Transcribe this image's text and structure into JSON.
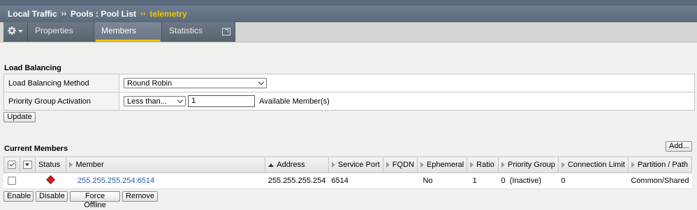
{
  "breadcrumb": {
    "items": [
      "Local Traffic",
      "Pools : Pool List"
    ],
    "separator": "››",
    "current": "telemetry"
  },
  "tabs": {
    "gear_icon": "gear-icon",
    "properties": "Properties",
    "members": "Members",
    "statistics": "Statistics"
  },
  "load_balancing": {
    "title": "Load Balancing",
    "method_label": "Load Balancing Method",
    "method_value": "Round Robin",
    "priority_label": "Priority Group Activation",
    "priority_value": "Less than...",
    "priority_input": "1",
    "priority_suffix": "Available Member(s)",
    "update_button": "Update"
  },
  "current_members": {
    "title": "Current Members",
    "add_button": "Add...",
    "columns": [
      "Status",
      "Member",
      "Address",
      "Service Port",
      "FQDN",
      "Ephemeral",
      "Ratio",
      "Priority Group",
      "Connection Limit",
      "Partition / Path"
    ],
    "rows": [
      {
        "status": "offline-red",
        "member": "255.255.255.254:6514",
        "address": "255.255.255.254",
        "service_port": "6514",
        "fqdn": "",
        "ephemeral": "No",
        "ratio": "1",
        "priority_group": "0  (Inactive)",
        "connection_limit": "0",
        "partition": "Common/Shared"
      }
    ],
    "buttons": [
      "Enable",
      "Disable",
      "Force Offline",
      "Remove"
    ]
  },
  "colors": {
    "header": "#5b6a7a",
    "accent": "#f2c200",
    "status_red": "#d0202a",
    "link": "#2b5aa8"
  }
}
